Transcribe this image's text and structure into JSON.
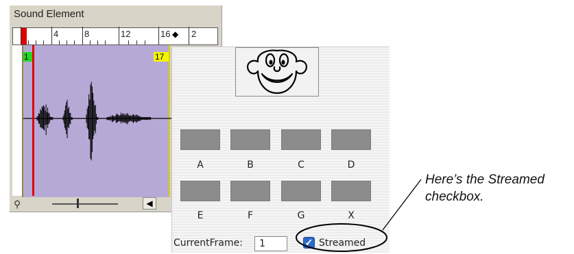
{
  "sound_element": {
    "title": "Sound Element",
    "ruler_labels": [
      "0",
      "4",
      "8",
      "12",
      "16",
      "2"
    ],
    "start_frame": "1",
    "end_frame": "17"
  },
  "stage": {
    "buttons": [
      "A",
      "B",
      "C",
      "D",
      "E",
      "F",
      "G",
      "X"
    ],
    "current_frame_label": "CurrentFrame:",
    "current_frame_value": "1",
    "streamed_label": "Streamed",
    "streamed_checked": true
  },
  "annotation": {
    "callout": "Here’s the Streamed checkbox."
  },
  "colors": {
    "wave_bg": "#b7a9d6",
    "playhead": "#e00000",
    "start_marker": "#24d624",
    "end_marker": "#f4f400",
    "checkbox": "#2b68c8"
  }
}
